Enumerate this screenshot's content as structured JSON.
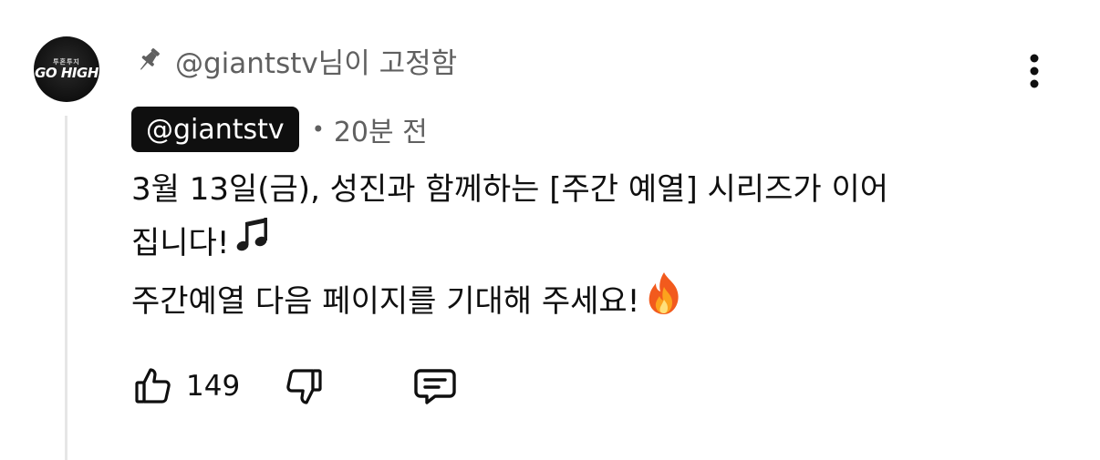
{
  "avatar": {
    "text_top": "투혼투지",
    "text_main": "GO HIGH"
  },
  "pinned": {
    "icon": "pin-icon",
    "text": "@giantstv님이 고정함"
  },
  "comment": {
    "author": "@giantstv",
    "separator": "•",
    "time": "20분 전",
    "lines": [
      "3월 13일(금), 성진과 함께하는 [주간 예열] 시리즈가 이어",
      "집니다!",
      "주간예열 다음 페이지를 기대해 주세요!"
    ],
    "emojis": [
      "music-notes-icon",
      "fire-icon"
    ]
  },
  "actions": {
    "like_icon": "thumbs-up-icon",
    "like_count": "149",
    "dislike_icon": "thumbs-down-icon",
    "reply_icon": "reply-comment-icon"
  },
  "menu_icon": "more-vertical-icon"
}
